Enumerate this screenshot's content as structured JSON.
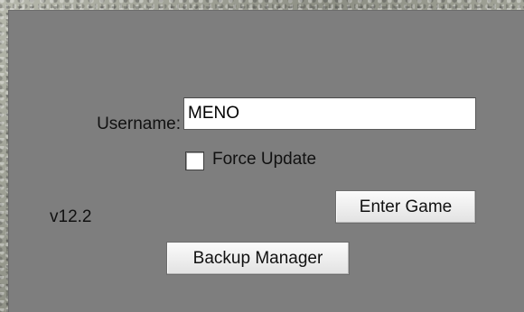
{
  "login": {
    "username_label": "Username:",
    "username_value": "MENO",
    "force_update_label": "Force Update",
    "force_update_checked": false,
    "version": "v12.2",
    "enter_game_label": "Enter Game",
    "backup_manager_label": "Backup Manager"
  },
  "colors": {
    "panel": "#7e7e7e",
    "button": "#efefef",
    "input": "#ffffff",
    "text": "#111111"
  }
}
